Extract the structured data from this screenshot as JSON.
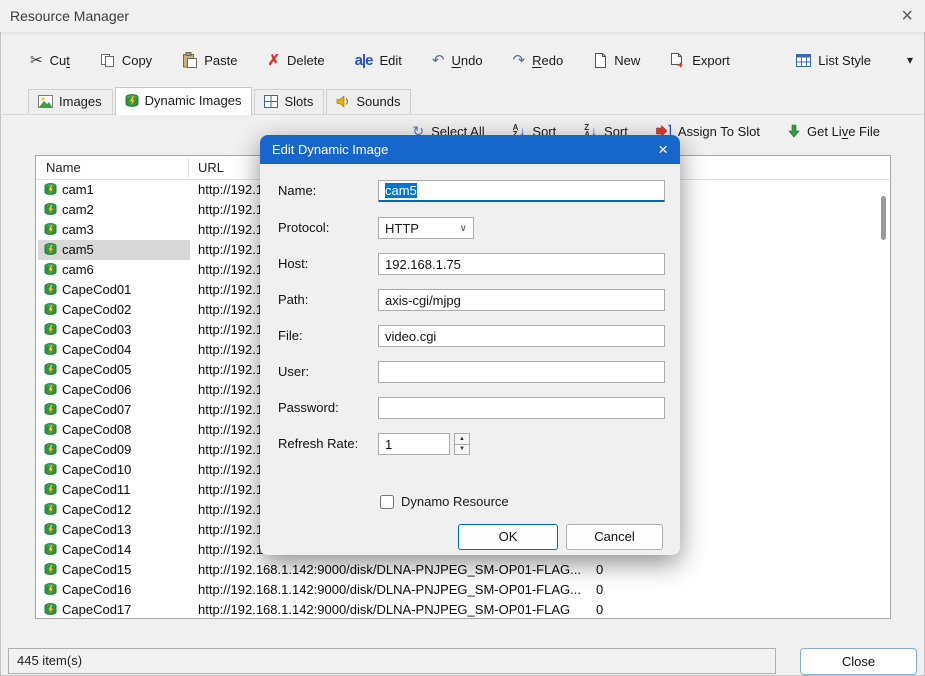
{
  "window": {
    "title": "Resource Manager"
  },
  "glyphs": {
    "close": "×",
    "dialog_close": "×",
    "cut": "✂",
    "delete": "✗",
    "rename": "a|e",
    "undo": "↶",
    "redo": "↷",
    "dropdown": "▾",
    "select_all": "↻",
    "sort_arrow": "↓",
    "letter_a": "A",
    "letter_z": "Z",
    "combo_chevron": "∨",
    "spin_up": "▲",
    "spin_down": "▼"
  },
  "toolbar": {
    "cut": {
      "label": "Cut",
      "m": 2
    },
    "copy": {
      "label": "Copy",
      "m": -1
    },
    "paste": {
      "label": "Paste",
      "m": -1
    },
    "delete": {
      "label": "Delete",
      "m": -1
    },
    "edit": {
      "label": "Edit",
      "m": -1
    },
    "undo": {
      "label": "Undo",
      "m": 0
    },
    "redo": {
      "label": "Redo",
      "m": 0
    },
    "new": {
      "label": "New",
      "m": -1
    },
    "export": {
      "label": "Export",
      "m": -1
    },
    "list_style": {
      "label": "List Style",
      "m": -1
    }
  },
  "tabs": [
    {
      "label": "Images",
      "active": false
    },
    {
      "label": "Dynamic Images",
      "active": true
    },
    {
      "label": "Slots",
      "active": false
    },
    {
      "label": "Sounds",
      "active": false
    }
  ],
  "actions": {
    "select_all": {
      "label": "Select All",
      "m": -1
    },
    "sort_asc": {
      "label": "Sort",
      "m": -1
    },
    "sort_desc": {
      "label": "Sort",
      "m": -1
    },
    "assign_to_slot": {
      "label": "Assign To Slot",
      "m": -1
    },
    "get_live_file": {
      "label": "Get Live File",
      "m": 6
    }
  },
  "list": {
    "columns": [
      "Name",
      "URL"
    ],
    "rows": [
      {
        "name": "cam1",
        "url": "http://192.1",
        "refresh": "",
        "selected": false
      },
      {
        "name": "cam2",
        "url": "http://192.1",
        "refresh": "",
        "selected": false
      },
      {
        "name": "cam3",
        "url": "http://192.1",
        "refresh": "",
        "selected": false
      },
      {
        "name": "cam5",
        "url": "http://192.1",
        "refresh": "",
        "selected": true
      },
      {
        "name": "cam6",
        "url": "http://192.1",
        "refresh": "",
        "selected": false
      },
      {
        "name": "CapeCod01",
        "url": "http://192.1",
        "refresh": "",
        "selected": false
      },
      {
        "name": "CapeCod02",
        "url": "http://192.1",
        "refresh": "",
        "selected": false
      },
      {
        "name": "CapeCod03",
        "url": "http://192.1",
        "refresh": "",
        "selected": false
      },
      {
        "name": "CapeCod04",
        "url": "http://192.1",
        "refresh": "",
        "selected": false
      },
      {
        "name": "CapeCod05",
        "url": "http://192.1",
        "refresh": "",
        "selected": false
      },
      {
        "name": "CapeCod06",
        "url": "http://192.1",
        "refresh": "",
        "selected": false
      },
      {
        "name": "CapeCod07",
        "url": "http://192.1",
        "refresh": "",
        "selected": false
      },
      {
        "name": "CapeCod08",
        "url": "http://192.1",
        "refresh": "",
        "selected": false
      },
      {
        "name": "CapeCod09",
        "url": "http://192.1",
        "refresh": "",
        "selected": false
      },
      {
        "name": "CapeCod10",
        "url": "http://192.1",
        "refresh": "",
        "selected": false
      },
      {
        "name": "CapeCod11",
        "url": "http://192.1",
        "refresh": "",
        "selected": false
      },
      {
        "name": "CapeCod12",
        "url": "http://192.1",
        "refresh": "",
        "selected": false
      },
      {
        "name": "CapeCod13",
        "url": "http://192.1",
        "refresh": "",
        "selected": false
      },
      {
        "name": "CapeCod14",
        "url": "http://192.1",
        "refresh": "",
        "selected": false
      },
      {
        "name": "CapeCod15",
        "url": "http://192.168.1.142:9000/disk/DLNA-PNJPEG_SM-OP01-FLAG...",
        "refresh": "0",
        "selected": false
      },
      {
        "name": "CapeCod16",
        "url": "http://192.168.1.142:9000/disk/DLNA-PNJPEG_SM-OP01-FLAG...",
        "refresh": "0",
        "selected": false
      },
      {
        "name": "CapeCod17",
        "url": "http://192.168.1.142:9000/disk/DLNA-PNJPEG_SM-OP01-FLAG",
        "refresh": "0",
        "selected": false
      }
    ]
  },
  "dialog": {
    "title": "Edit Dynamic Image",
    "fields": {
      "name": {
        "label": "Name:",
        "value": "cam5"
      },
      "protocol": {
        "label": "Protocol:",
        "value": "HTTP"
      },
      "host": {
        "label": "Host:",
        "value": "192.168.1.75"
      },
      "path": {
        "label": "Path:",
        "value": "axis-cgi/mjpg"
      },
      "file": {
        "label": "File:",
        "value": "video.cgi"
      },
      "user": {
        "label": "User:",
        "value": ""
      },
      "password": {
        "label": "Password:",
        "value": ""
      },
      "refresh_rate": {
        "label": "Refresh Rate:",
        "value": "1"
      }
    },
    "checkbox": {
      "label": "Dynamo Resource",
      "checked": false
    },
    "buttons": {
      "ok": "OK",
      "cancel": "Cancel"
    }
  },
  "statusbar": {
    "count": "445 item(s)",
    "close_label": "Close"
  }
}
